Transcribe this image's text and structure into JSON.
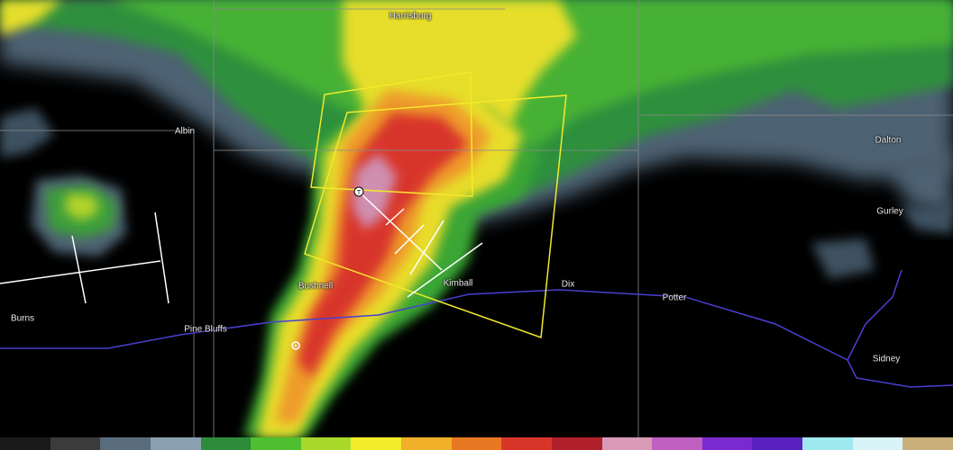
{
  "map": {
    "towns": [
      {
        "id": "harrisburg",
        "name": "Harrisburg"
      },
      {
        "id": "albin",
        "name": "Albin"
      },
      {
        "id": "dalton",
        "name": "Dalton"
      },
      {
        "id": "gurley",
        "name": "Gurley"
      },
      {
        "id": "bushnell",
        "name": "Bushnell"
      },
      {
        "id": "kimball",
        "name": "Kimball"
      },
      {
        "id": "dix",
        "name": "Dix"
      },
      {
        "id": "potter",
        "name": "Potter"
      },
      {
        "id": "burns",
        "name": "Burns"
      },
      {
        "id": "pine-bluffs",
        "name": "Pine Bluffs"
      },
      {
        "id": "sidney",
        "name": "Sidney"
      }
    ],
    "colors": {
      "background": "#000000",
      "county_line": "#8a8a8a",
      "highway": "#4a3fd0",
      "warning_polygon": "#f2ea2a",
      "overlay_lines": "#ffffff"
    },
    "icons": [
      "tornado-marker-icon",
      "storm-target-icon"
    ],
    "reflectivity_scale_colors": [
      "#1a1a1a",
      "#3b3b3b",
      "#5a6d7d",
      "#8aa0b0",
      "#2e8b3a",
      "#4fbf2f",
      "#a8d82a",
      "#f2ec2a",
      "#f0b02a",
      "#e87722",
      "#d9362a",
      "#b0202a",
      "#d99ab8",
      "#c060c0",
      "#7a2ad0",
      "#5a20c0",
      "#9ee8f0",
      "#d8f4f8",
      "#c9b07a"
    ]
  }
}
